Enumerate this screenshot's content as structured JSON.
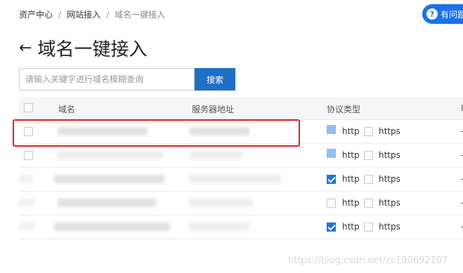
{
  "breadcrumb": {
    "items": [
      "资产中心",
      "网站接入",
      "域名一键接入"
    ],
    "separator": "/"
  },
  "help_button": {
    "label": "有问题",
    "icon": "question-icon"
  },
  "page": {
    "title": "域名一键接入",
    "back_icon": "arrow-left-icon"
  },
  "search": {
    "placeholder": "请输入关键字进行域名模糊查询",
    "value": "",
    "button_label": "搜索"
  },
  "table": {
    "columns": {
      "domain": "域名",
      "server": "服务器地址",
      "protocol": "协议类型",
      "more": "I"
    },
    "rows": [
      {
        "http_checked": false,
        "https_checked": false,
        "http": "http",
        "https": "https",
        "trail": "-"
      },
      {
        "http_checked": false,
        "https_checked": false,
        "http": "http",
        "https": "https",
        "trail": "-"
      },
      {
        "http_checked": true,
        "https_checked": false,
        "http": "http",
        "https": "https",
        "trail": "-"
      },
      {
        "http_checked": false,
        "https_checked": false,
        "http": "http",
        "https": "https",
        "trail": "-"
      },
      {
        "http_checked": true,
        "https_checked": false,
        "http": "http",
        "https": "https",
        "trail": "-"
      }
    ]
  },
  "watermark": "https://blog.csdn.net/zc190692107",
  "colors": {
    "accent": "#1a73e8",
    "highlight": "#e02020"
  }
}
